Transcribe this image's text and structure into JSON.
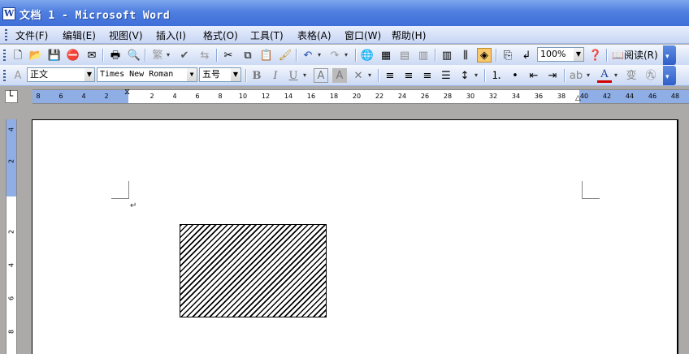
{
  "window": {
    "title": "文档 1 - Microsoft Word"
  },
  "menu": {
    "items": [
      "文件(F)",
      "编辑(E)",
      "视图(V)",
      "插入(I)",
      "格式(O)",
      "工具(T)",
      "表格(A)",
      "窗口(W)",
      "帮助(H)"
    ]
  },
  "standard_toolbar": {
    "zoom": "100%",
    "read_label": "阅读(R)"
  },
  "format_toolbar": {
    "style": "正文",
    "font": "Times New Roman",
    "size": "五号"
  },
  "ruler": {
    "h_ticks": [
      "8",
      "6",
      "4",
      "2",
      "2",
      "4",
      "6",
      "8",
      "10",
      "12",
      "14",
      "16",
      "18",
      "20",
      "22",
      "24",
      "26",
      "28",
      "30",
      "32",
      "34",
      "36",
      "38",
      "40",
      "42",
      "44",
      "46",
      "48"
    ],
    "v_ticks": [
      "4",
      "2",
      "2",
      "4",
      "6",
      "8"
    ]
  },
  "document": {
    "paragraph_mark": "↵"
  }
}
